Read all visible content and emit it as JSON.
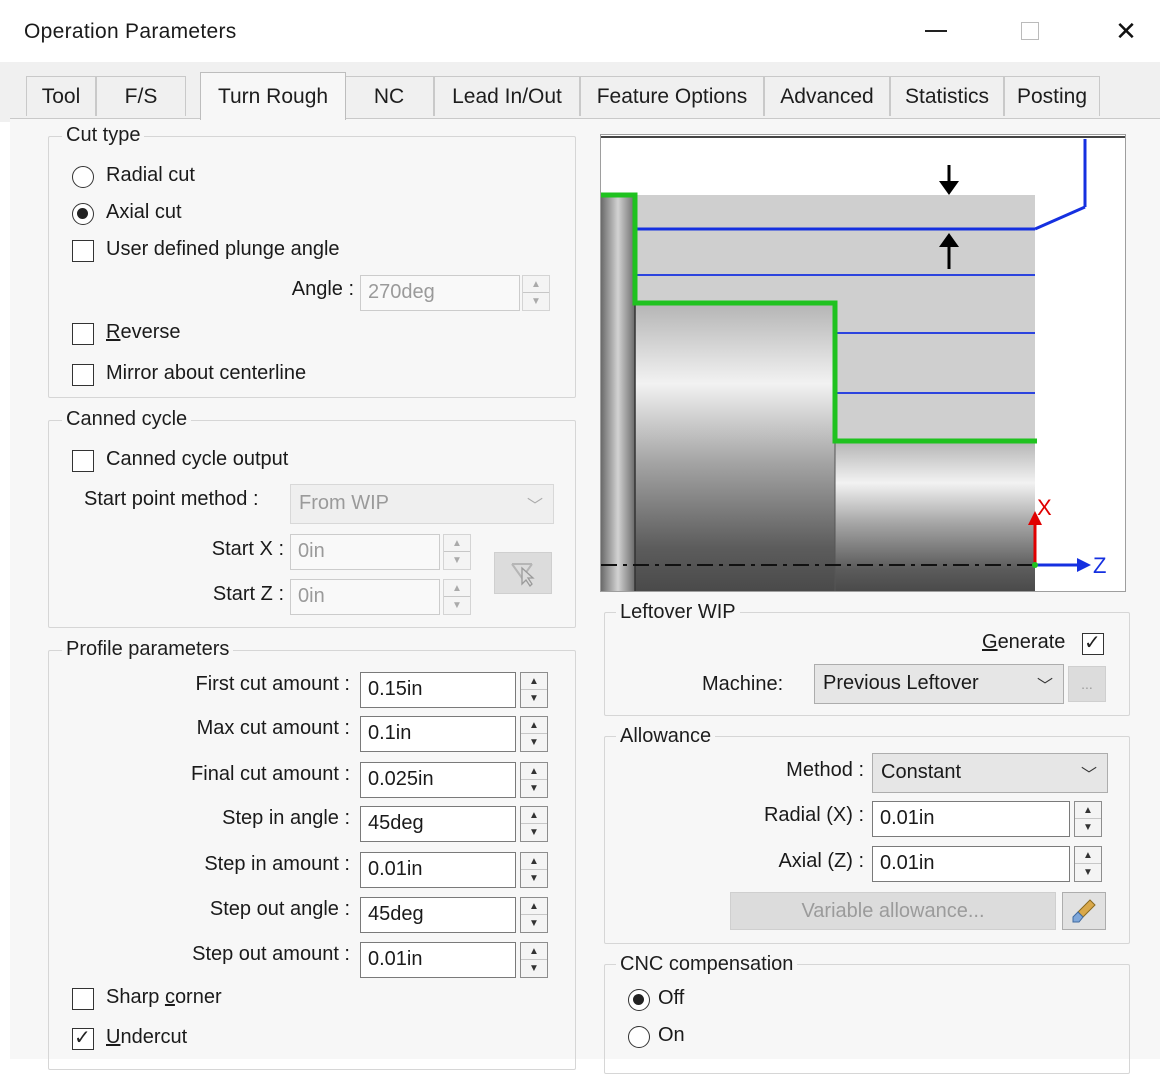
{
  "window": {
    "title": "Operation Parameters"
  },
  "tabs": [
    {
      "label": "Tool"
    },
    {
      "label": "F/S"
    },
    {
      "label": "Turn Rough"
    },
    {
      "label": "NC"
    },
    {
      "label": "Lead In/Out"
    },
    {
      "label": "Feature Options"
    },
    {
      "label": "Advanced"
    },
    {
      "label": "Statistics"
    },
    {
      "label": "Posting"
    }
  ],
  "active_tab": "Turn Rough",
  "cut_type": {
    "title": "Cut type",
    "radial_label": "Radial cut",
    "axial_label": "Axial cut",
    "selected": "Axial cut",
    "plunge_label": "User defined plunge angle",
    "plunge_checked": false,
    "angle_label": "Angle :",
    "angle_value": "270deg",
    "reverse_label": "Reverse",
    "reverse_checked": false,
    "mirror_label": "Mirror about centerline",
    "mirror_checked": false
  },
  "canned_cycle": {
    "title": "Canned cycle",
    "output_label": "Canned cycle output",
    "output_checked": false,
    "start_method_label": "Start point method :",
    "start_method_value": "From WIP",
    "start_x_label": "Start X :",
    "start_x_value": "0in",
    "start_z_label": "Start Z :",
    "start_z_value": "0in"
  },
  "profile": {
    "title": "Profile parameters",
    "rows": [
      {
        "label": "First cut amount :",
        "value": "0.15in"
      },
      {
        "label": "Max cut amount :",
        "value": "0.1in"
      },
      {
        "label": "Final cut amount :",
        "value": "0.025in"
      },
      {
        "label": "Step in angle :",
        "value": "45deg"
      },
      {
        "label": "Step in amount :",
        "value": "0.01in"
      },
      {
        "label": "Step out angle :",
        "value": "45deg"
      },
      {
        "label": "Step out amount :",
        "value": "0.01in"
      }
    ],
    "sharp_corner_label": "Sharp corner",
    "sharp_corner_checked": false,
    "undercut_label": "Undercut",
    "undercut_checked": true
  },
  "preview": {
    "x_axis": "X",
    "z_axis": "Z"
  },
  "leftover": {
    "title": "Leftover WIP",
    "generate_label": "Generate",
    "generate_checked": true,
    "machine_label": "Machine:",
    "machine_value": "Previous Leftover",
    "browse_label": "..."
  },
  "allowance": {
    "title": "Allowance",
    "method_label": "Method :",
    "method_value": "Constant",
    "radial_label": "Radial (X) :",
    "radial_value": "0.01in",
    "axial_label": "Axial (Z) :",
    "axial_value": "0.01in",
    "variable_label": "Variable allowance..."
  },
  "cnc": {
    "title": "CNC compensation",
    "off_label": "Off",
    "on_label": "On",
    "selected": "Off"
  },
  "colors": {
    "toolpath_blue": "#1530e0",
    "profile_green": "#1fc21f",
    "stock_gray": "#cfcfcf"
  }
}
